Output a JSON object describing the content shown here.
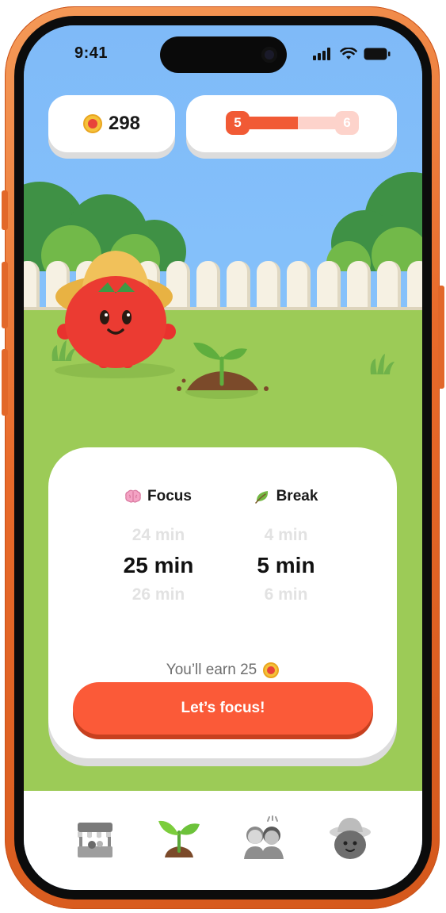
{
  "status_bar": {
    "time": "9:41"
  },
  "header": {
    "coins": "298",
    "level": {
      "current": "5",
      "next": "6",
      "progress": 0.55
    }
  },
  "timer": {
    "focus": {
      "title": "Focus",
      "prev": "24 min",
      "current": "25 min",
      "next": "26 min"
    },
    "break": {
      "title": "Break",
      "prev": "4 min",
      "current": "5 min",
      "next": "6 min"
    },
    "earn_text": "You’ll earn 25",
    "cta_label": "Let’s focus!"
  },
  "colors": {
    "accent": "#FB5A38",
    "sky": "#7EBDFA",
    "grass": "#9CCB57",
    "phone_frame": "#E86A2A"
  },
  "tab_bar": {
    "items": [
      {
        "icon": "shop-stand-icon",
        "active": false
      },
      {
        "icon": "sprout-icon",
        "active": true
      },
      {
        "icon": "friends-icon",
        "active": false
      },
      {
        "icon": "farmer-avatar-icon",
        "active": false
      }
    ]
  }
}
